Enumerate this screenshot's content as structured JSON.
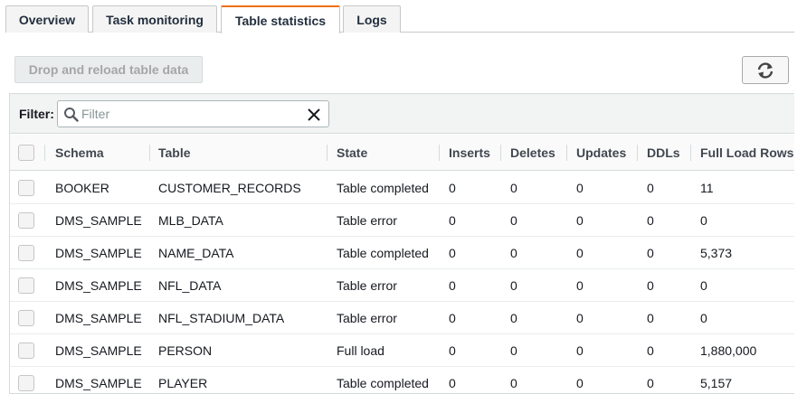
{
  "tabs": [
    {
      "label": "Overview",
      "active": false
    },
    {
      "label": "Task monitoring",
      "active": false
    },
    {
      "label": "Table statistics",
      "active": true
    },
    {
      "label": "Logs",
      "active": false
    }
  ],
  "toolbar": {
    "drop_reload_label": "Drop and reload table data",
    "refresh_icon": "refresh-icon"
  },
  "filter": {
    "label": "Filter:",
    "placeholder": "Filter",
    "value": ""
  },
  "table": {
    "columns": [
      "Schema",
      "Table",
      "State",
      "Inserts",
      "Deletes",
      "Updates",
      "DDLs",
      "Full Load Rows"
    ],
    "rows": [
      [
        "BOOKER",
        "CUSTOMER_RECORDS",
        "Table completed",
        "0",
        "0",
        "0",
        "0",
        "11"
      ],
      [
        "DMS_SAMPLE",
        "MLB_DATA",
        "Table error",
        "0",
        "0",
        "0",
        "0",
        "0"
      ],
      [
        "DMS_SAMPLE",
        "NAME_DATA",
        "Table completed",
        "0",
        "0",
        "0",
        "0",
        "5,373"
      ],
      [
        "DMS_SAMPLE",
        "NFL_DATA",
        "Table error",
        "0",
        "0",
        "0",
        "0",
        "0"
      ],
      [
        "DMS_SAMPLE",
        "NFL_STADIUM_DATA",
        "Table error",
        "0",
        "0",
        "0",
        "0",
        "0"
      ],
      [
        "DMS_SAMPLE",
        "PERSON",
        "Full load",
        "0",
        "0",
        "0",
        "0",
        "1,880,000"
      ],
      [
        "DMS_SAMPLE",
        "PLAYER",
        "Table completed",
        "0",
        "0",
        "0",
        "0",
        "5,157"
      ]
    ]
  },
  "colors": {
    "active_tab_accent": "#ec7211",
    "header_bg": "#fafafa",
    "filter_bg": "#f2f3f3"
  }
}
